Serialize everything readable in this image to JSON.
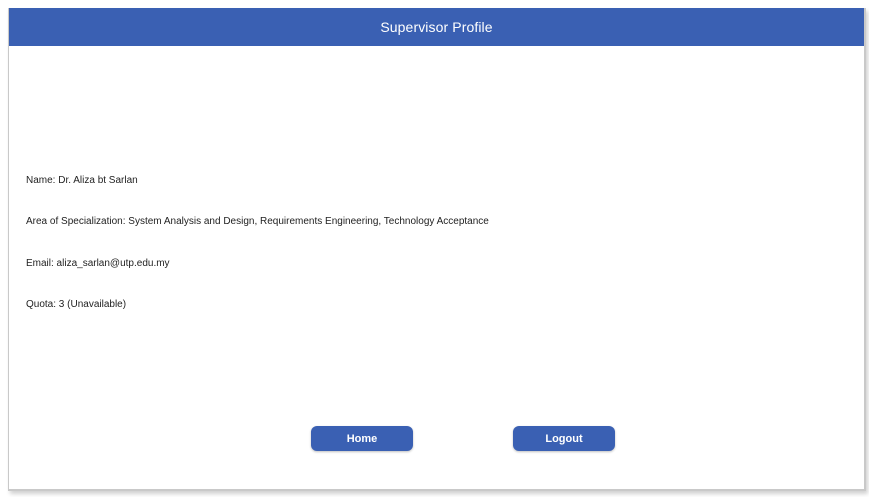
{
  "header": {
    "title": "Supervisor Profile"
  },
  "profile": {
    "name": "Name: Dr. Aliza bt Sarlan",
    "specialization": "Area of Specialization: System Analysis and Design, Requirements Engineering, Technology Acceptance",
    "email": "Email: aliza_sarlan@utp.edu.my",
    "quota": "Quota: 3 (Unavailable)"
  },
  "actions": {
    "home_label": "Home",
    "logout_label": "Logout"
  },
  "colors": {
    "header_bg": "#3a60b3",
    "button_bg": "#3a60b3",
    "text": "#222222"
  }
}
